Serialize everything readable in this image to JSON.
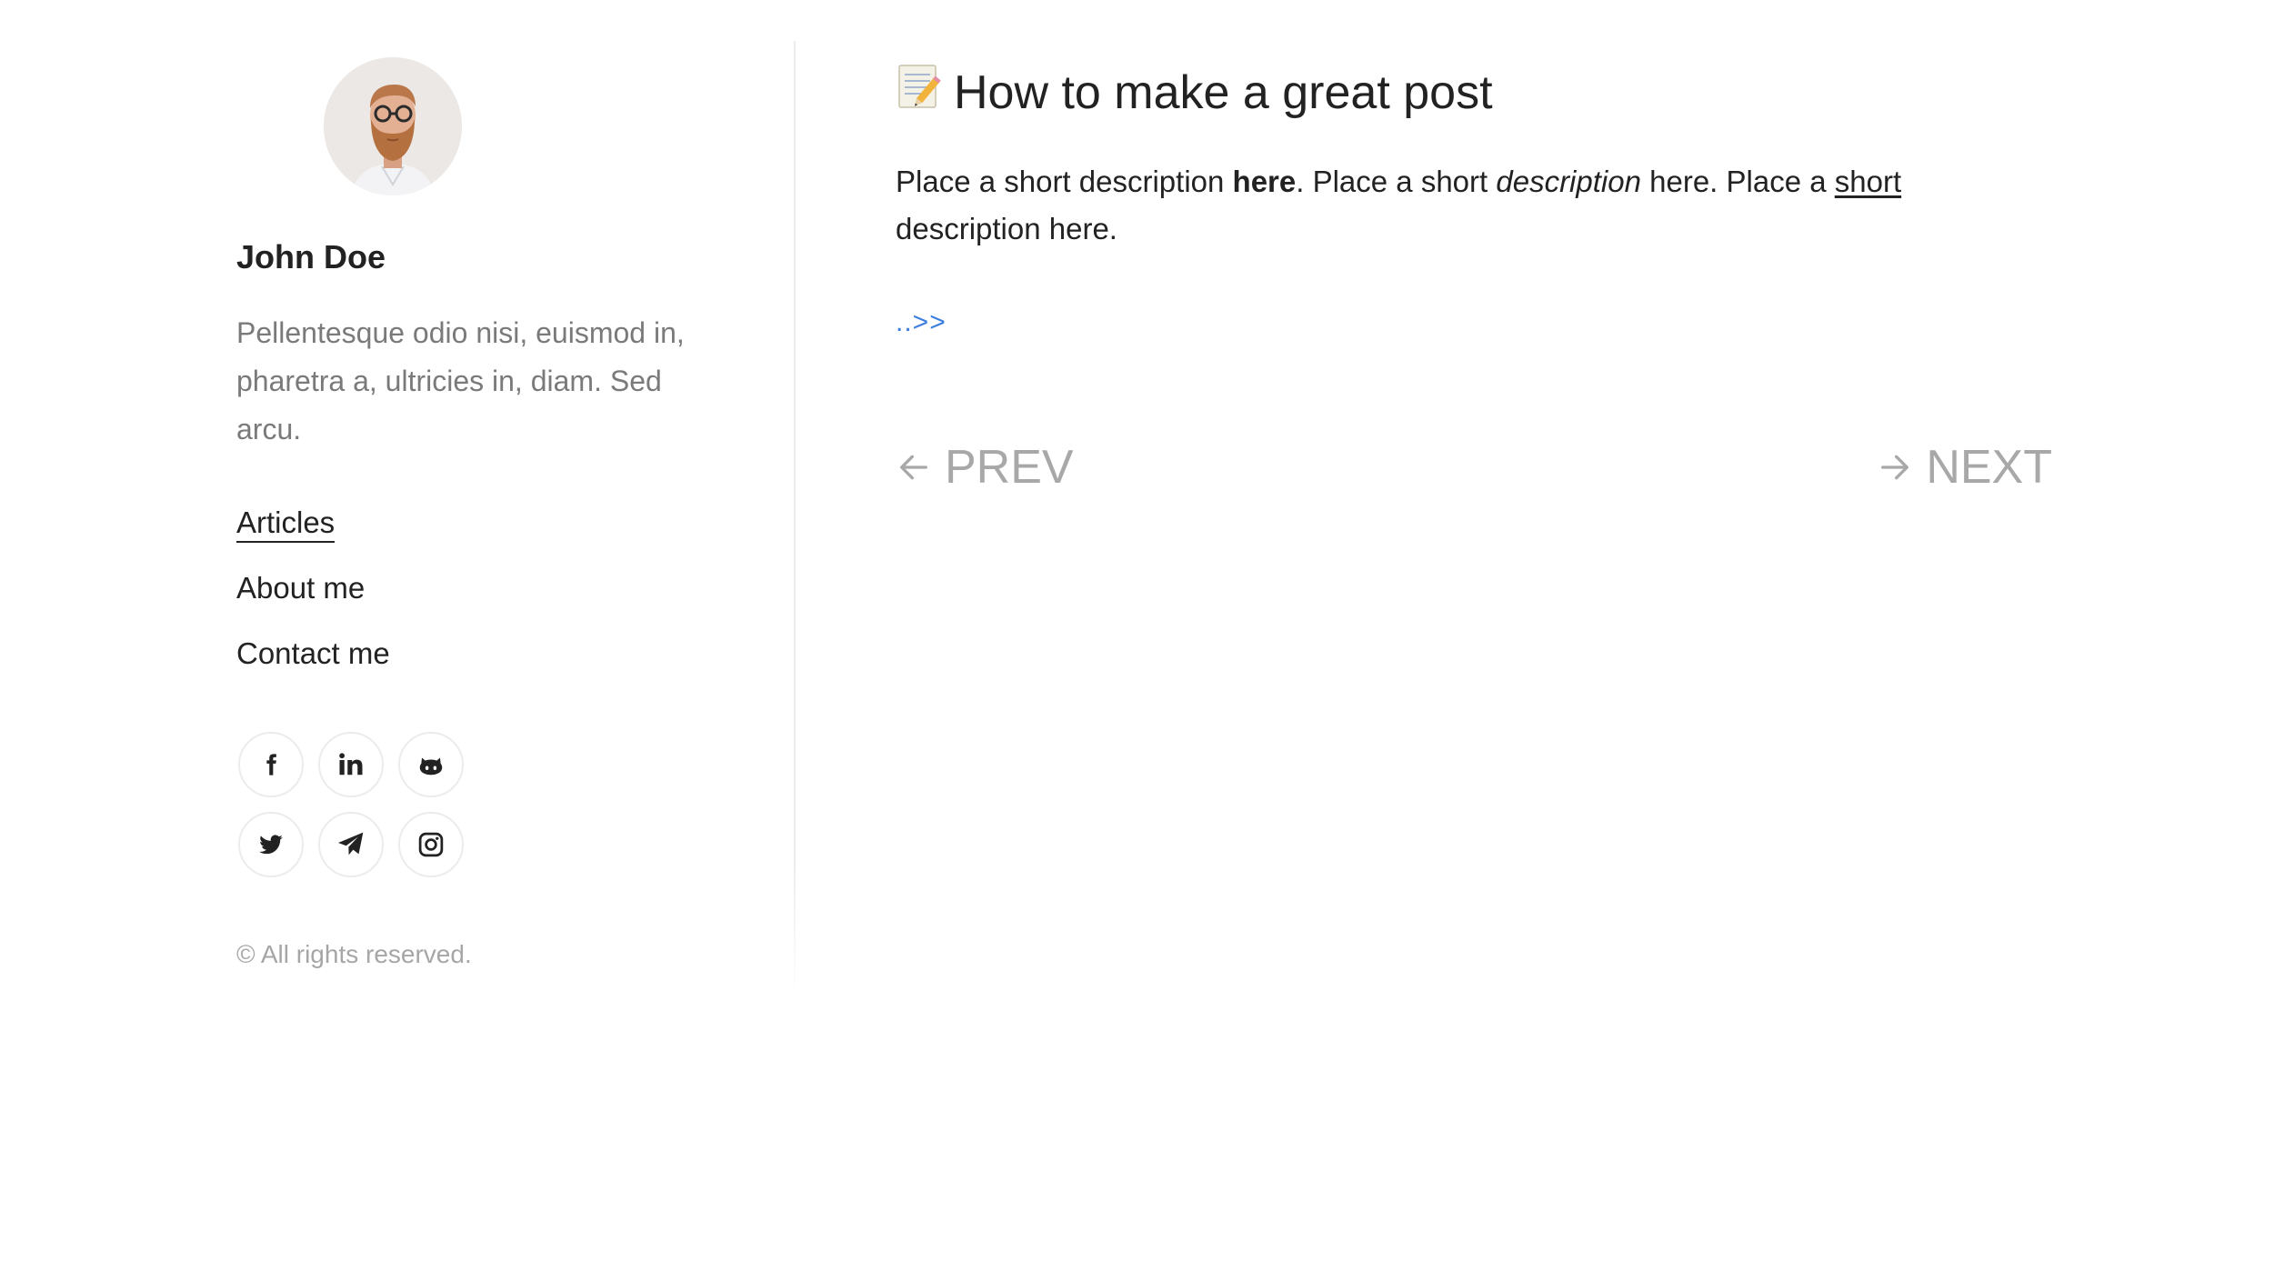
{
  "sidebar": {
    "author_name": "John Doe",
    "bio": "Pellentesque odio nisi, euismod in, pharetra a, ultricies in, diam. Sed arcu.",
    "nav": [
      {
        "label": "Articles",
        "active": true
      },
      {
        "label": "About me",
        "active": false
      },
      {
        "label": "Contact me",
        "active": false
      }
    ],
    "socials": [
      {
        "icon": "facebook-icon"
      },
      {
        "icon": "linkedin-icon"
      },
      {
        "icon": "github-icon"
      },
      {
        "icon": "twitter-icon"
      },
      {
        "icon": "telegram-icon"
      },
      {
        "icon": "instagram-icon"
      }
    ],
    "copyright": "© All rights reserved."
  },
  "post": {
    "title_icon": "memo-icon",
    "title": "How to make a great post",
    "desc_parts": {
      "p1": "Place a short description ",
      "bold": "here",
      "p2": ". Place a short ",
      "italic": "description",
      "p3": " here. Place a ",
      "underline": "short",
      "p4": " description here."
    },
    "more_link": "..>>"
  },
  "pager": {
    "prev_label": "PREV",
    "next_label": "NEXT"
  },
  "colors": {
    "text": "#222222",
    "muted": "#7a7a7a",
    "light": "#a8a8a8",
    "link": "#3b7ee0",
    "border": "#ececec"
  }
}
